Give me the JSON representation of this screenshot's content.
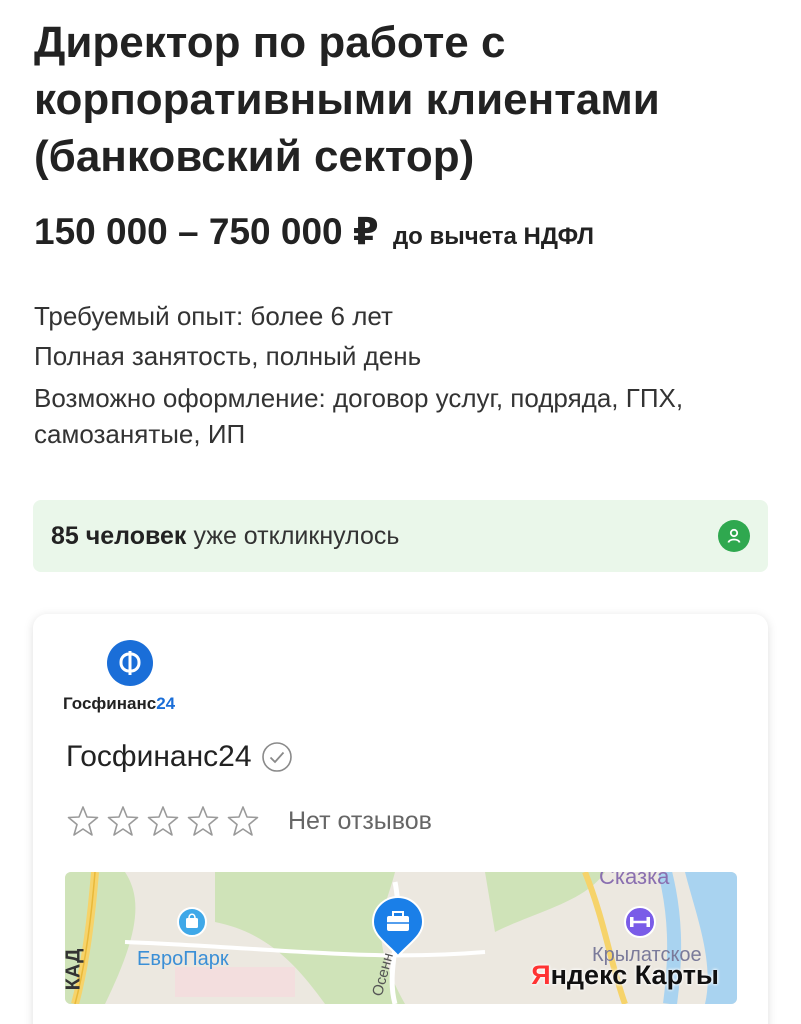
{
  "vacancy": {
    "title": "Директор по работе с корпоративными клиентами (банковский сектор)",
    "salary": "150 000 – 750 000 ₽",
    "salary_note": "до вычета НДФЛ",
    "experience": "Требуемый опыт: более 6 лет",
    "employment": "Полная занятость, полный день",
    "contract": "Возможно оформление: договор услуг, подряда, ГПХ, самозанятые, ИП"
  },
  "responses": {
    "count": "85 человек",
    "text": "уже откликнулось",
    "icon": "person-icon",
    "accent": "#2fa84f"
  },
  "company": {
    "logo_text": "Госфинанс",
    "logo_number": "24",
    "name": "Госфинанс24",
    "verified_icon": "check-circle-icon",
    "rating_stars": 0,
    "reviews": "Нет отзывов"
  },
  "map": {
    "labels": {
      "kad": "КАД",
      "europark": "ЕвроПарк",
      "skazka": "Сказка",
      "krylatskoe": "Крылатское",
      "osen": "Осенн"
    },
    "brand_first": "Я",
    "brand_rest": "ндекс Карты"
  },
  "colors": {
    "brand_blue": "#1a6ed8",
    "map_pin": "#1a7fe8",
    "shop_pin": "#3fa8e8",
    "sport_pin": "#7a5ce8"
  }
}
